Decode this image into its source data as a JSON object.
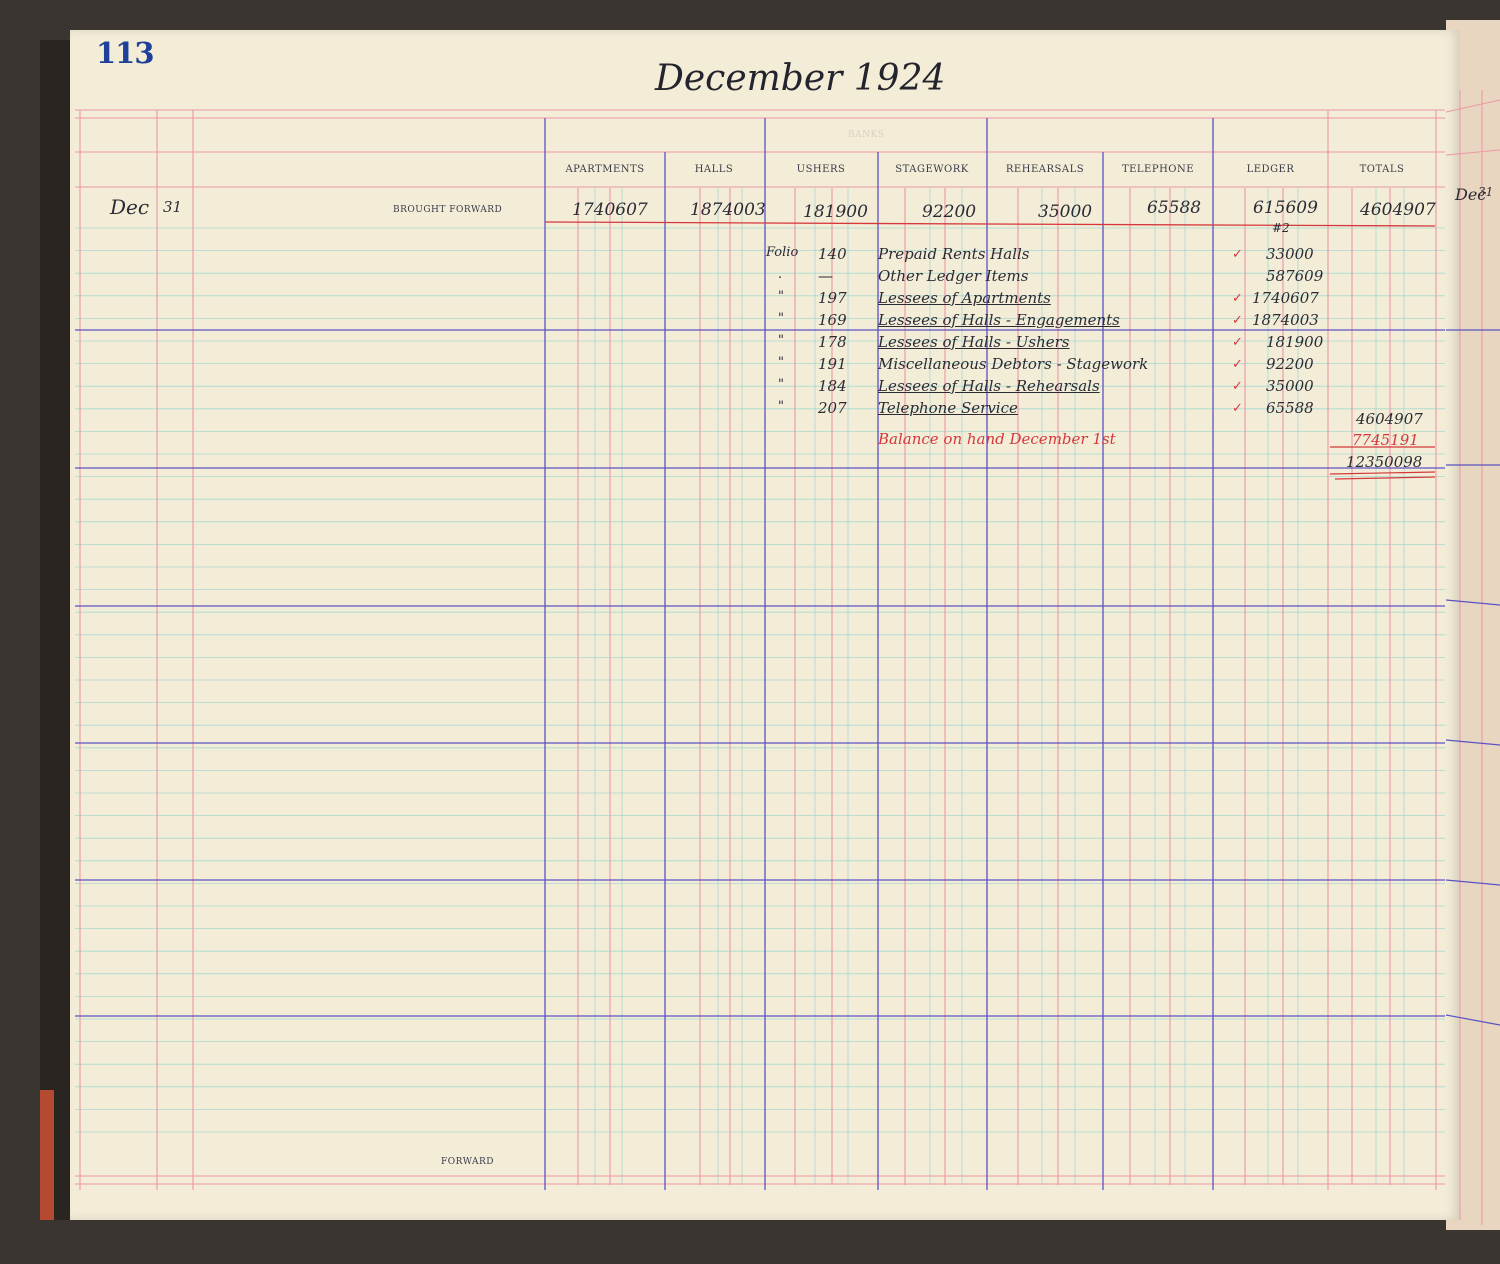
{
  "page_number": "113",
  "title": "December 1924",
  "faded_header": "BANKS",
  "columns": [
    "APARTMENTS",
    "HALLS",
    "USHERS",
    "STAGEWORK",
    "REHEARSALS",
    "TELEPHONE",
    "LEDGER",
    "TOTALS"
  ],
  "brought_forward": {
    "month": "Dec",
    "day": "31",
    "label": "Brought Forward",
    "values": [
      "1740607",
      "1874003",
      "181900",
      "92200",
      "35000",
      "65588",
      "615609",
      "4604907"
    ],
    "ledger_note": "#2"
  },
  "entries": [
    {
      "mark": "Folio",
      "folio": "140",
      "description": "Prepaid Rents Halls",
      "ledger": "33000"
    },
    {
      "mark": ".",
      "folio": "—",
      "description": "Other Ledger Items",
      "ledger": "587609"
    },
    {
      "mark": "\"",
      "folio": "197",
      "description": "Lessees of Apartments",
      "ledger": "1740607"
    },
    {
      "mark": "\"",
      "folio": "169",
      "description": "Lessees of Halls - Engagements",
      "ledger": "1874003"
    },
    {
      "mark": "\"",
      "folio": "178",
      "description": "Lessees of Halls - Ushers",
      "ledger": "181900"
    },
    {
      "mark": "\"",
      "folio": "191",
      "description": "Miscellaneous Debtors - Stagework",
      "ledger": "92200"
    },
    {
      "mark": "\"",
      "folio": "184",
      "description": "Lessees of Halls - Rehearsals",
      "ledger": "35000"
    },
    {
      "mark": "\"",
      "folio": "207",
      "description": "Telephone Service",
      "ledger": "65588"
    }
  ],
  "totals": {
    "line_total": "4604907",
    "balance_label": "Balance on hand December 1st",
    "balance_value": "7745191",
    "grand_total": "12350098"
  },
  "footer_label": "Forward",
  "next_page": {
    "month": "Dec",
    "day": "31"
  },
  "colors": {
    "paper": "#f3edd8",
    "blue_rule": "#5a4fc2",
    "red_rule": "#e88a9a",
    "green_rule": "#9fd0c8",
    "page_number": "#1e3f9a",
    "red_ink": "#d4383c"
  }
}
